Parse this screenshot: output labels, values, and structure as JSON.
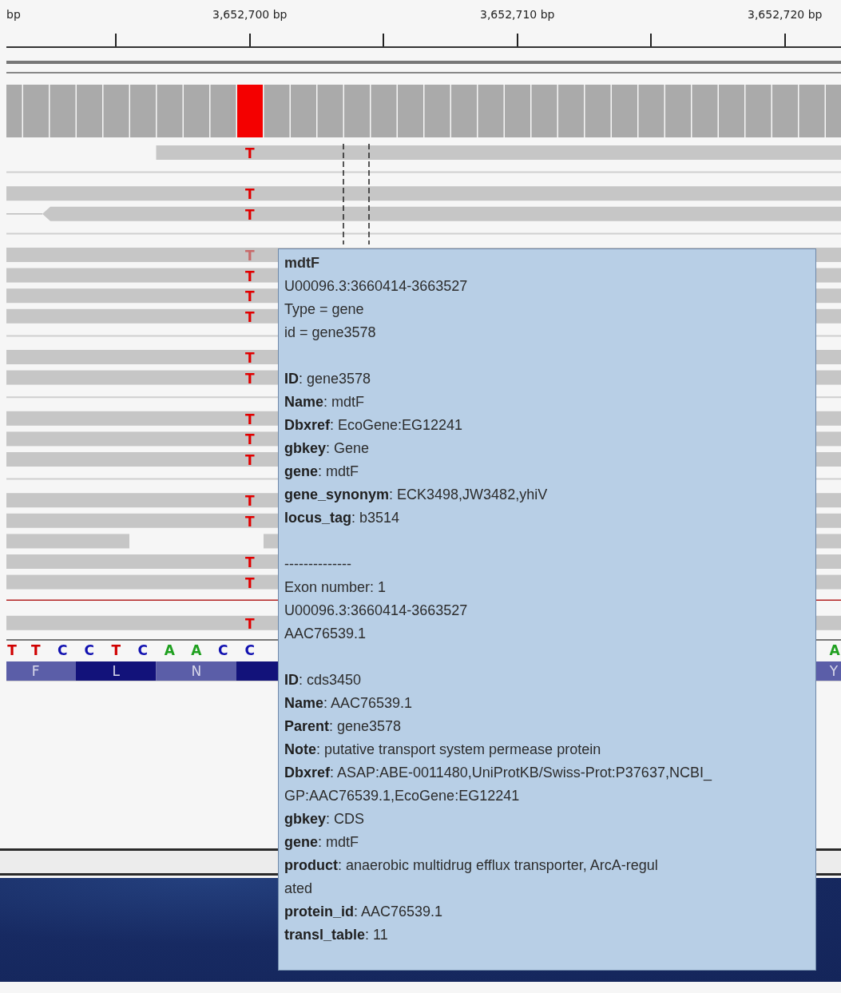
{
  "ruler": {
    "unit": "bp",
    "labels": [
      "3,652,700 bp",
      "3,652,710 bp",
      "3,652,720 bp"
    ]
  },
  "coverage": [
    {
      "mismatch": false
    },
    {
      "mismatch": false
    },
    {
      "mismatch": false
    },
    {
      "mismatch": false
    },
    {
      "mismatch": false
    },
    {
      "mismatch": false
    },
    {
      "mismatch": false
    },
    {
      "mismatch": false
    },
    {
      "mismatch": false
    },
    {
      "mismatch": true
    },
    {
      "mismatch": false
    },
    {
      "mismatch": false
    },
    {
      "mismatch": false
    },
    {
      "mismatch": false
    },
    {
      "mismatch": false
    },
    {
      "mismatch": false
    },
    {
      "mismatch": false
    },
    {
      "mismatch": false
    },
    {
      "mismatch": false
    },
    {
      "mismatch": false
    },
    {
      "mismatch": false
    },
    {
      "mismatch": false
    },
    {
      "mismatch": false
    },
    {
      "mismatch": false
    },
    {
      "mismatch": false
    },
    {
      "mismatch": false
    },
    {
      "mismatch": false
    },
    {
      "mismatch": false
    },
    {
      "mismatch": false
    },
    {
      "mismatch": false
    },
    {
      "mismatch": false
    },
    {
      "mismatch": false
    }
  ],
  "reads": [
    {
      "kind": "partial",
      "base": "T",
      "faded": false
    },
    {
      "kind": "separator"
    },
    {
      "kind": "full",
      "base": "T",
      "faded": false
    },
    {
      "kind": "arrow",
      "base": "T",
      "faded": false
    },
    {
      "kind": "separator"
    },
    {
      "kind": "full",
      "base": "T",
      "faded": true
    },
    {
      "kind": "full",
      "base": "T",
      "faded": false
    },
    {
      "kind": "full",
      "base": "T",
      "faded": false
    },
    {
      "kind": "full",
      "base": "T",
      "faded": false
    },
    {
      "kind": "separator"
    },
    {
      "kind": "full",
      "base": "T",
      "faded": false
    },
    {
      "kind": "full",
      "base": "T",
      "faded": false
    },
    {
      "kind": "separator"
    },
    {
      "kind": "full",
      "base": "T",
      "faded": false
    },
    {
      "kind": "full",
      "base": "T",
      "faded": false
    },
    {
      "kind": "full",
      "base": "T",
      "faded": false
    },
    {
      "kind": "separator"
    },
    {
      "kind": "full",
      "base": "T",
      "faded": false
    },
    {
      "kind": "full",
      "base": "T",
      "faded": false
    },
    {
      "kind": "split"
    },
    {
      "kind": "full",
      "base": "T",
      "faded": false
    },
    {
      "kind": "full",
      "base": "T",
      "faded": false
    },
    {
      "kind": "red_line"
    },
    {
      "kind": "full",
      "base": "T",
      "faded": false
    }
  ],
  "sequence": {
    "left": [
      {
        "base": "T",
        "color": "#d00000"
      },
      {
        "base": "T",
        "color": "#d00000"
      },
      {
        "base": "C",
        "color": "#1010b0"
      },
      {
        "base": "C",
        "color": "#1010b0"
      },
      {
        "base": "T",
        "color": "#d00000"
      },
      {
        "base": "C",
        "color": "#1010b0"
      },
      {
        "base": "A",
        "color": "#20a020"
      },
      {
        "base": "A",
        "color": "#20a020"
      },
      {
        "base": "C",
        "color": "#1010b0"
      },
      {
        "base": "C",
        "color": "#1010b0"
      }
    ],
    "right": [
      {
        "base": "A",
        "color": "#20a020"
      }
    ]
  },
  "translation": {
    "left": [
      "F",
      "L",
      "N"
    ],
    "right": [
      "Y"
    ]
  },
  "popup": {
    "lines": [
      {
        "kind": "title",
        "text": "mdtF"
      },
      {
        "kind": "text",
        "text": "U00096.3:3660414-3663527"
      },
      {
        "kind": "text",
        "text": "Type = gene"
      },
      {
        "kind": "text",
        "text": "id = gene3578"
      },
      {
        "kind": "blank"
      },
      {
        "kind": "text",
        "text": "**ID**: gene3578"
      },
      {
        "kind": "text",
        "text": "**Name**: mdtF"
      },
      {
        "kind": "text",
        "text": "**Dbxref**: EcoGene:EG12241"
      },
      {
        "kind": "text",
        "text": "**gbkey**: Gene"
      },
      {
        "kind": "text",
        "text": "**gene**: mdtF"
      },
      {
        "kind": "text",
        "text": "**gene_synonym**: ECK3498,JW3482,yhiV"
      },
      {
        "kind": "text",
        "text": "**locus_tag**: b3514"
      },
      {
        "kind": "blank"
      },
      {
        "kind": "text",
        "text": "--------------"
      },
      {
        "kind": "text",
        "text": "Exon number: 1"
      },
      {
        "kind": "text",
        "text": "U00096.3:3660414-3663527"
      },
      {
        "kind": "text",
        "text": "AAC76539.1"
      },
      {
        "kind": "blank"
      },
      {
        "kind": "text",
        "text": "**ID**: cds3450"
      },
      {
        "kind": "text",
        "text": "**Name**: AAC76539.1"
      },
      {
        "kind": "text",
        "text": "**Parent**: gene3578"
      },
      {
        "kind": "text",
        "text": "**Note**: putative transport system permease protein"
      },
      {
        "kind": "text",
        "text": "**Dbxref**: ASAP:ABE-0011480,UniProtKB/Swiss-Prot:P37637,NCBI_"
      },
      {
        "kind": "text",
        "text": "GP:AAC76539.1,EcoGene:EG12241"
      },
      {
        "kind": "text",
        "text": "**gbkey**: CDS"
      },
      {
        "kind": "text",
        "text": "**gene**: mdtF"
      },
      {
        "kind": "text",
        "text": "**product**: anaerobic multidrug efflux transporter, ArcA-regul"
      },
      {
        "kind": "text",
        "text": "ated"
      },
      {
        "kind": "text",
        "text": "**protein_id**: AAC76539.1"
      },
      {
        "kind": "text",
        "text": "**transl_table**: 11"
      }
    ]
  }
}
